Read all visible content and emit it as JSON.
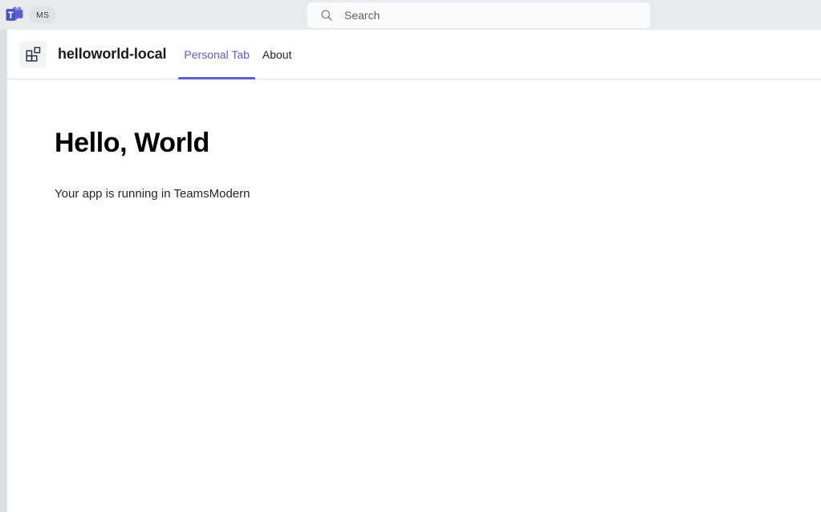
{
  "top_bar": {
    "logo_icon": "teams-logo-icon",
    "org_badge": "MS",
    "search": {
      "icon": "search-icon",
      "placeholder": "Search",
      "value": ""
    }
  },
  "app": {
    "icon": "apps-grid-icon",
    "title": "helloworld-local",
    "tabs": [
      {
        "label": "Personal Tab",
        "active": true
      },
      {
        "label": "About",
        "active": false
      }
    ]
  },
  "content": {
    "heading": "Hello, World",
    "subtext": "Your app is running in TeamsModern"
  },
  "colors": {
    "accent": "#5b5fc7",
    "top_bar_bg": "#e9eaeb",
    "gutter": "#dedfe0",
    "surface": "#ffffff",
    "text": "#242424"
  }
}
